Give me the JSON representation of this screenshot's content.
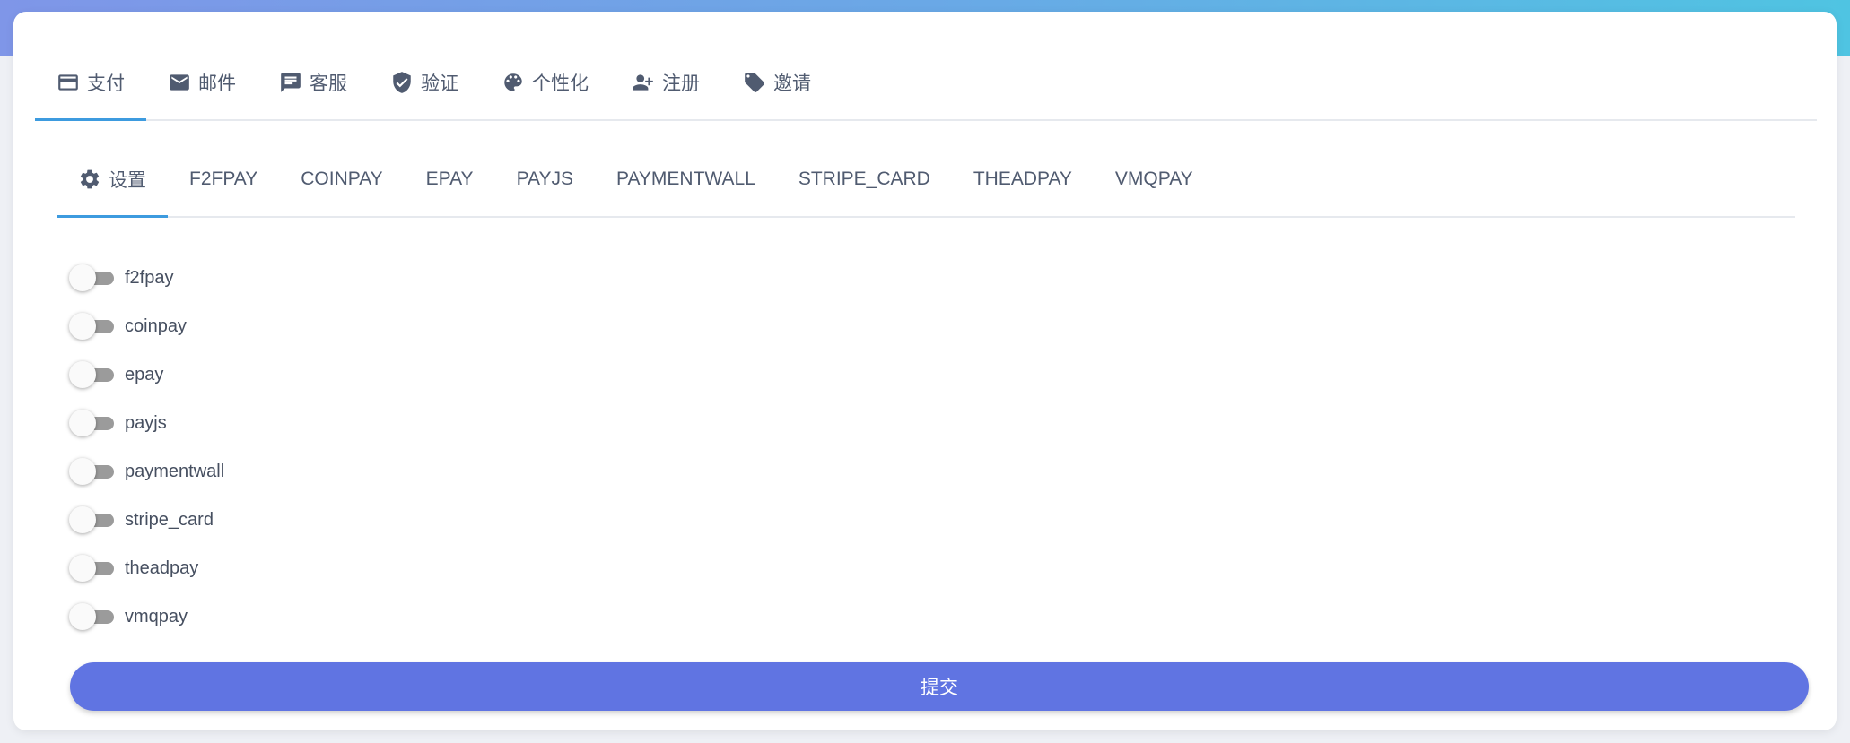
{
  "main_tabs": [
    {
      "label": "支付",
      "icon": "credit-card-icon"
    },
    {
      "label": "邮件",
      "icon": "mail-icon"
    },
    {
      "label": "客服",
      "icon": "chat-icon"
    },
    {
      "label": "验证",
      "icon": "shield-check-icon"
    },
    {
      "label": "个性化",
      "icon": "palette-icon"
    },
    {
      "label": "注册",
      "icon": "user-plus-icon"
    },
    {
      "label": "邀请",
      "icon": "tag-icon"
    }
  ],
  "sub_tabs": [
    {
      "label": "设置",
      "icon": "gear-icon"
    },
    {
      "label": "F2FPAY"
    },
    {
      "label": "COINPAY"
    },
    {
      "label": "EPAY"
    },
    {
      "label": "PAYJS"
    },
    {
      "label": "PAYMENTWALL"
    },
    {
      "label": "STRIPE_CARD"
    },
    {
      "label": "THEADPAY"
    },
    {
      "label": "VMQPAY"
    }
  ],
  "toggles": [
    {
      "label": "f2fpay",
      "enabled": false
    },
    {
      "label": "coinpay",
      "enabled": false
    },
    {
      "label": "epay",
      "enabled": false
    },
    {
      "label": "payjs",
      "enabled": false
    },
    {
      "label": "paymentwall",
      "enabled": false
    },
    {
      "label": "stripe_card",
      "enabled": false
    },
    {
      "label": "theadpay",
      "enabled": false
    },
    {
      "label": "vmqpay",
      "enabled": false
    }
  ],
  "submit_label": "提交",
  "colors": {
    "accent": "#3d9bdf",
    "button": "#6074e2",
    "text": "#505b70"
  }
}
